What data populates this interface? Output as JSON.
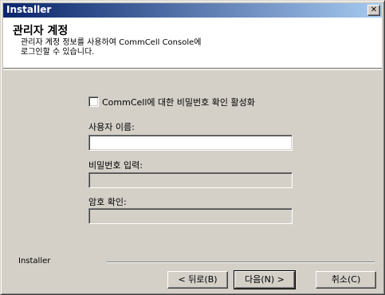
{
  "window": {
    "title": "Installer",
    "close_glyph": "✕"
  },
  "header": {
    "title": "관리자 계정",
    "subtitle_line1": "관리자 계정 정보를 사용하여 CommCell Console에",
    "subtitle_line2": "로그인할 수 있습니다."
  },
  "form": {
    "enable_password_check": {
      "label": "CommCell에 대한 비밀번호 확인 활성화",
      "checked": false
    },
    "username": {
      "label": "사용자 이름:",
      "value": "",
      "enabled": true
    },
    "password": {
      "label": "비밀번호 입력:",
      "value": "",
      "enabled": false
    },
    "confirm": {
      "label": "암호 확인:",
      "value": "",
      "enabled": false
    }
  },
  "footer": {
    "brand_label": "Installer"
  },
  "buttons": {
    "back_label": "< 뒤로(B)",
    "next_label": "다음(N) >",
    "cancel_label": "취소(C)"
  },
  "colors": {
    "dialog_face": "#d4d0c8",
    "title_bar": "#0a246a",
    "header_bg": "#ffffff"
  }
}
